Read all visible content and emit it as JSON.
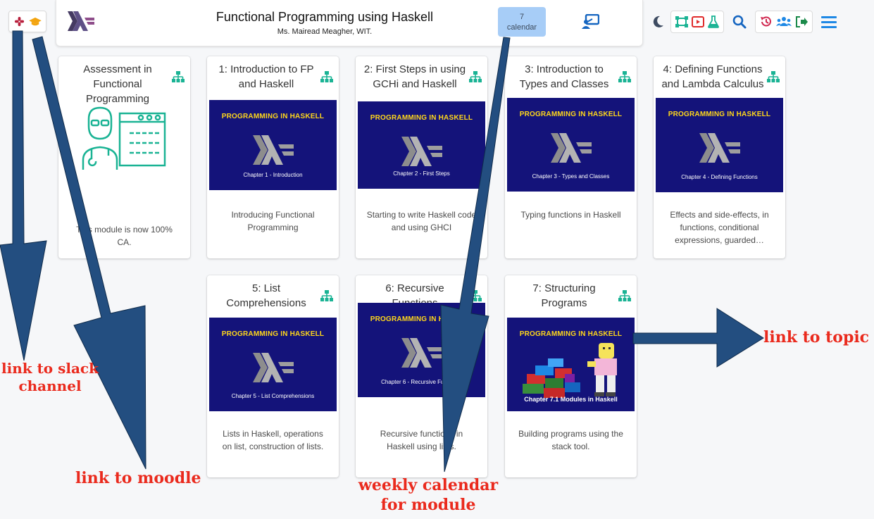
{
  "header": {
    "title": "Functional Programming using Haskell",
    "subtitle": "Ms. Mairead Meagher, WIT.",
    "calendar": {
      "week": "7",
      "label": "calendar"
    }
  },
  "external_links": [
    "slack-icon",
    "moodle-icon"
  ],
  "toolbar": {
    "icons": [
      "dark-mode-icon",
      "tutors-icon",
      "video-icon",
      "lab-icon",
      "search-icon",
      "history-icon",
      "online-users-icon",
      "logout-icon",
      "menu-icon"
    ]
  },
  "cards": [
    {
      "title": "Assessment in Functional Programming",
      "image_type": "illustration",
      "description": "This module is now 100% CA."
    },
    {
      "title": "1: Introduction to FP and Haskell",
      "image_type": "slide",
      "image_heading": "PROGRAMMING IN HASKELL",
      "image_caption": "Chapter 1 - Introduction",
      "description": "Introducing Functional Programming"
    },
    {
      "title": "2: First Steps in using GCHi and Haskell",
      "image_type": "slide",
      "image_heading": "PROGRAMMING IN HASKELL",
      "image_caption": "Chapter 2 - First Steps",
      "description": "Starting to write Haskell code and using GHCI"
    },
    {
      "title": "3: Introduction to Types and Classes",
      "image_type": "slide",
      "image_heading": "PROGRAMMING IN HASKELL",
      "image_caption": "Chapter 3 - Types and Classes",
      "description": "Typing functions in Haskell"
    },
    {
      "title": "4: Defining Functions and Lambda Calculus",
      "image_type": "slide",
      "image_heading": "PROGRAMMING IN HASKELL",
      "image_caption": "Chapter 4 - Defining Functions",
      "description": "Effects and side-effects, in functions, conditional expressions, guarded…"
    },
    {
      "title": "5: List Comprehensions",
      "image_type": "slide",
      "image_heading": "PROGRAMMING IN HASKELL",
      "image_caption": "Chapter 5 - List Comprehensions",
      "description": "Lists in Haskell, operations on list, construction of lists."
    },
    {
      "title": "6: Recursive Functions",
      "image_type": "slide",
      "image_heading": "PROGRAMMING IN HASKELL",
      "image_caption": "Chapter 6 - Recursive Functions",
      "description": "Recursive functions in Haskell using lists."
    },
    {
      "title": "7: Structuring Programs",
      "image_type": "lego-slide",
      "image_heading": "PROGRAMMING IN HASKELL",
      "image_caption": "Chapter 7.1 Modules in Haskell",
      "description": "Building programs using the stack tool."
    }
  ],
  "annotations": {
    "slack": "link to slack\nchannel",
    "moodle": "link to moodle",
    "calendar": "weekly calendar\nfor module",
    "topic": "link to topic"
  },
  "colors": {
    "accent_green": "#1ab394",
    "calendar_bg": "#a7cdf7",
    "slide_bg": "#14137a",
    "annotation_red": "#ea2a1d",
    "arrow_blue": "#1f4c7c"
  }
}
